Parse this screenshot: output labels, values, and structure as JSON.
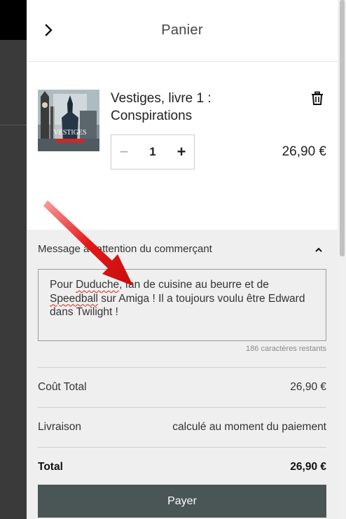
{
  "header": {
    "title": "Panier"
  },
  "item": {
    "title": "Vestiges, livre 1 : Conspirations",
    "quantity": "1",
    "minus_label": "−",
    "plus_label": "+",
    "price": "26,90 €",
    "cover_text": "VESTIGES"
  },
  "note": {
    "label": "Message à l'attention du commerçant",
    "text_parts": [
      "Pour ",
      "Duduche",
      ", fan de cuisine au beurre et de ",
      "Speedball",
      " sur Amiga ! Il a toujours voulu être Edward dans Twilight !"
    ],
    "chars_left": "186 caractères restants"
  },
  "summary": {
    "rows": [
      {
        "label": "Coût Total",
        "value": "26,90 €"
      },
      {
        "label": "Livraison",
        "value": "calculé au moment du paiement"
      },
      {
        "label": "Total",
        "value": "26,90 €"
      }
    ]
  },
  "pay_button": {
    "label": "Payer"
  },
  "colors": {
    "pay_button": "#4a5655",
    "panel_bg": "#efefef",
    "annotation_arrow": "#e41818"
  }
}
